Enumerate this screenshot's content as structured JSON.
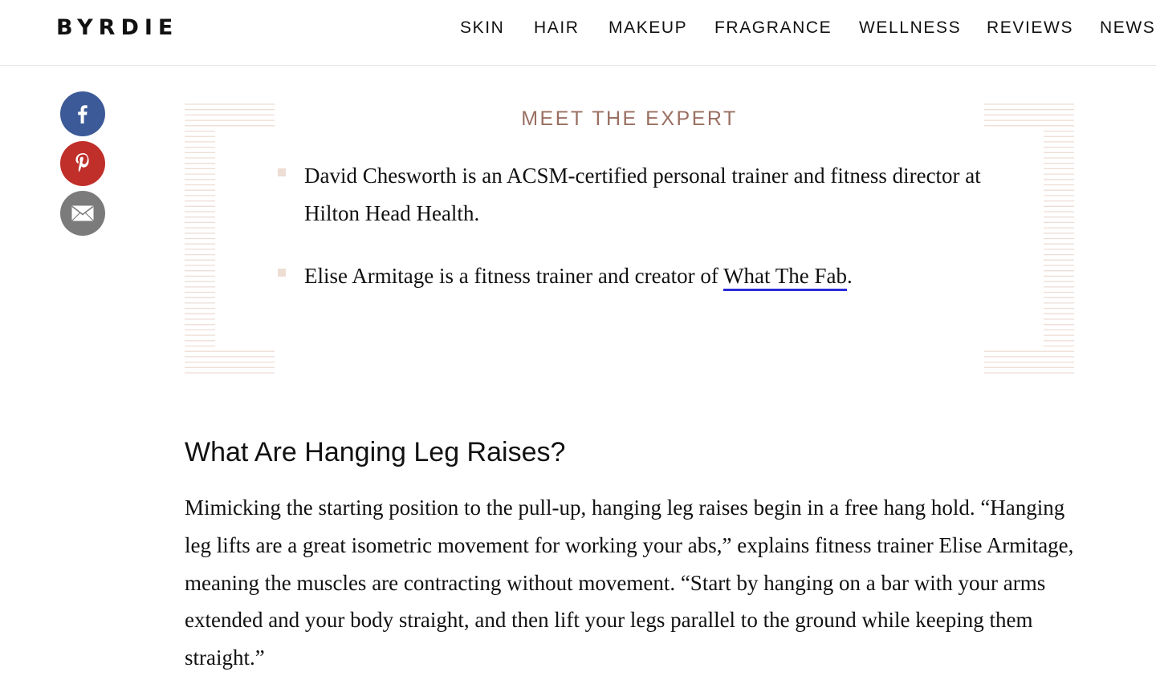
{
  "header": {
    "logo": "BYRDIE",
    "nav": [
      "SKIN",
      "HAIR",
      "MAKEUP",
      "FRAGRANCE",
      "WELLNESS",
      "REVIEWS",
      "NEWS"
    ]
  },
  "share": {
    "icons": [
      "facebook-icon",
      "pinterest-icon",
      "email-icon"
    ],
    "colors": {
      "facebook": "#3d5a98",
      "pinterest": "#c02f2a",
      "email": "#7b7b7b"
    }
  },
  "expert_box": {
    "title": "MEET THE EXPERT",
    "items": [
      {
        "text": "David Chesworth is an ACSM-certified personal trainer and fitness director at Hilton Head Health."
      },
      {
        "text_before": "Elise Armitage is a fitness trainer and creator of ",
        "link": "What The Fab",
        "text_after": "."
      }
    ],
    "accent_color": "#9a6f62",
    "link_underline_color": "#2b2bd8"
  },
  "article": {
    "heading": "What Are Hanging Leg Raises?",
    "paragraph": "Mimicking the starting position to the pull-up, hanging leg raises begin in a free hang hold. “Hanging leg lifts are a great isometric movement for working your abs,” explains fitness trainer Elise Armitage, meaning the muscles are contracting without movement. “Start by hanging on a bar with your arms extended and your body straight, and then lift your legs parallel to the ground while keeping them straight.”"
  }
}
